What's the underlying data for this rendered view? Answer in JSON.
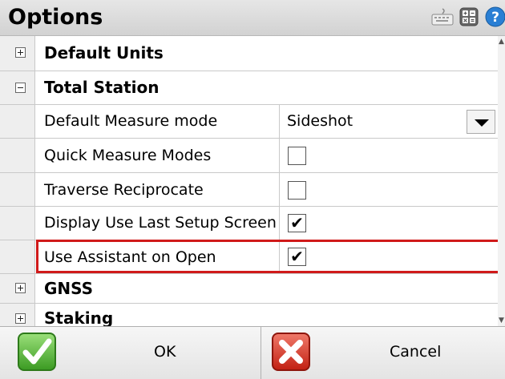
{
  "window": {
    "title": "Options"
  },
  "toolbar": {
    "icons": [
      "keyboard-icon",
      "calculator-icon",
      "help-icon"
    ]
  },
  "groups": {
    "default_units": {
      "label": "Default Units",
      "expanded": false
    },
    "total_station": {
      "label": "Total Station",
      "expanded": true
    },
    "gnss": {
      "label": "GNSS",
      "expanded": false
    },
    "staking": {
      "label": "Staking",
      "expanded": false
    }
  },
  "properties": {
    "default_measure_mode": {
      "label": "Default Measure mode",
      "value": "Sideshot"
    },
    "quick_measure_modes": {
      "label": "Quick Measure Modes",
      "checked": false
    },
    "traverse_reciprocate": {
      "label": "Traverse Reciprocate",
      "checked": false
    },
    "display_use_last_setup": {
      "label": "Display Use Last Setup Screen",
      "checked": true
    },
    "use_assistant_on_open": {
      "label": "Use Assistant on Open",
      "checked": true
    }
  },
  "checkmark": "✔",
  "highlight_color": "#d01a1a",
  "footer": {
    "ok_label": "OK",
    "cancel_label": "Cancel"
  }
}
